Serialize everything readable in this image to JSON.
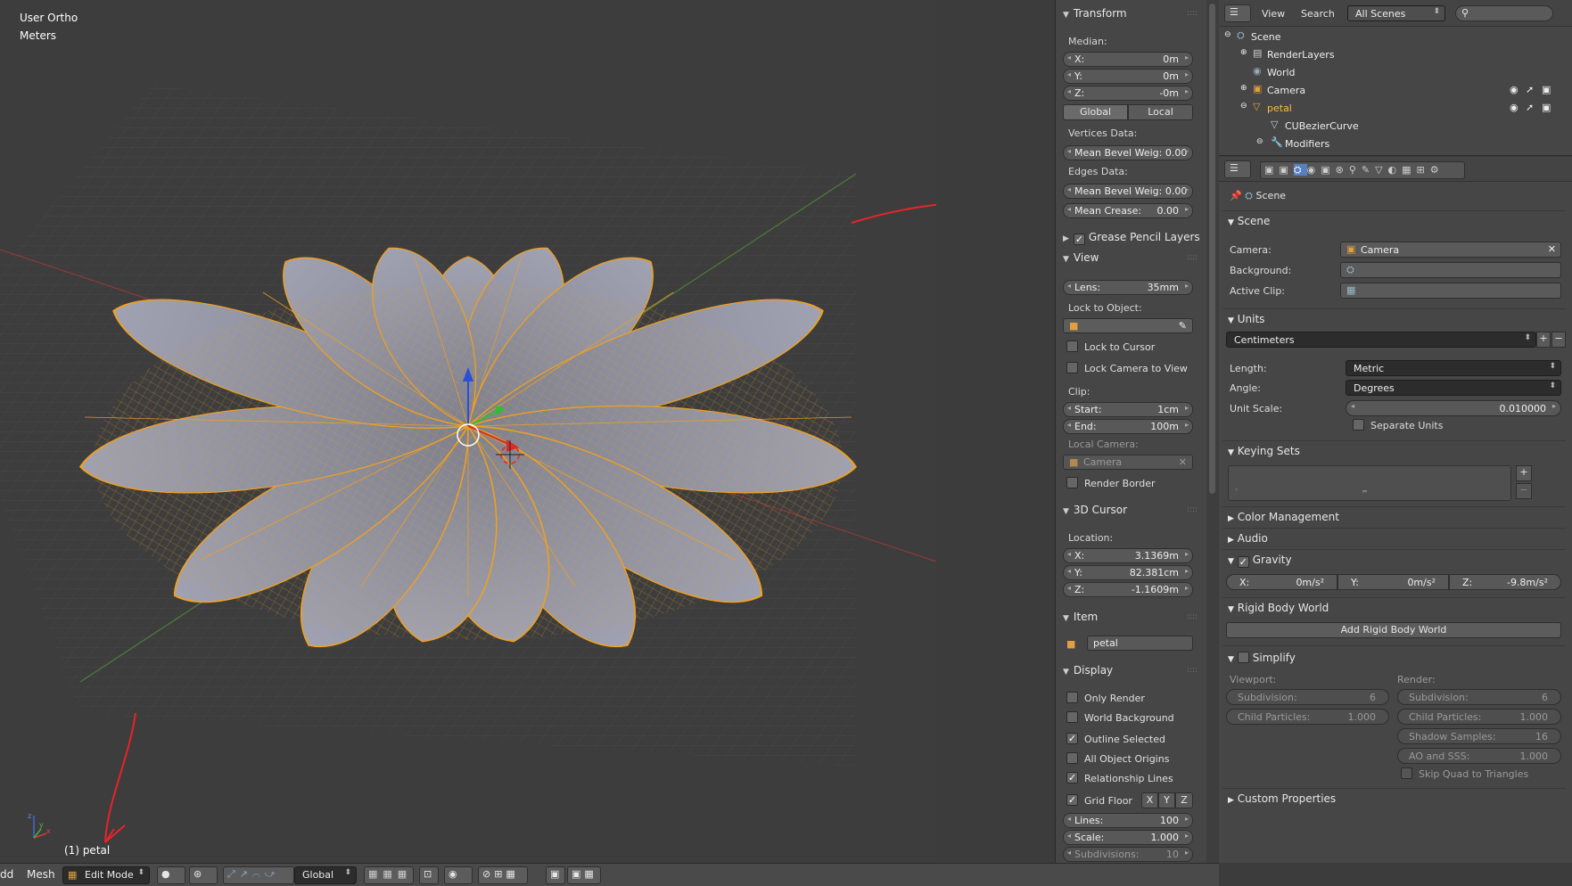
{
  "viewport": {
    "view_name": "User Ortho",
    "units": "Meters",
    "object_label": "(1) petal"
  },
  "npanel": {
    "transform": {
      "title": "Transform",
      "median_label": "Median:",
      "x": {
        "k": "X:",
        "v": "0m"
      },
      "y": {
        "k": "Y:",
        "v": "0m"
      },
      "z": {
        "k": "Z:",
        "v": "-0m"
      },
      "global": "Global",
      "local": "Local",
      "vertices_data": "Vertices Data:",
      "mean_bevel_v": "Mean Bevel Weig: 0.00",
      "edges_data": "Edges Data:",
      "mean_bevel_e": "Mean Bevel Weig: 0.00",
      "mean_crease_k": "Mean Crease:",
      "mean_crease_v": "0.00"
    },
    "grease_pencil": "Grease Pencil Layers",
    "view": {
      "title": "View",
      "lens_k": "Lens:",
      "lens_v": "35mm",
      "lock_to_object": "Lock to Object:",
      "lock_to_cursor": "Lock to Cursor",
      "lock_camera": "Lock Camera to View",
      "clip": "Clip:",
      "start_k": "Start:",
      "start_v": "1cm",
      "end_k": "End:",
      "end_v": "100m",
      "local_camera": "Local Camera:",
      "camera": "Camera",
      "render_border": "Render Border"
    },
    "cursor": {
      "title": "3D Cursor",
      "location": "Location:",
      "x": {
        "k": "X:",
        "v": "3.1369m"
      },
      "y": {
        "k": "Y:",
        "v": "82.381cm"
      },
      "z": {
        "k": "Z:",
        "v": "-1.1609m"
      }
    },
    "item": {
      "title": "Item",
      "name": "petal"
    },
    "display": {
      "title": "Display",
      "only_render": "Only Render",
      "world_background": "World Background",
      "outline_selected": "Outline Selected",
      "all_object_origins": "All Object Origins",
      "relationship_lines": "Relationship Lines",
      "grid_floor": "Grid Floor",
      "x": "X",
      "y": "Y",
      "z": "Z",
      "lines_k": "Lines:",
      "lines_v": "100",
      "scale_k": "Scale:",
      "scale_v": "1.000",
      "subdiv_k": "Subdivisions:",
      "subdiv_v": "10"
    }
  },
  "outliner": {
    "view": "View",
    "search": "Search",
    "scenes": "All Scenes",
    "items": [
      {
        "label": "Scene"
      },
      {
        "label": "RenderLayers"
      },
      {
        "label": "World"
      },
      {
        "label": "Camera"
      },
      {
        "label": "petal"
      },
      {
        "label": "CUBezierCurve"
      },
      {
        "label": "Modifiers"
      }
    ]
  },
  "properties": {
    "breadcrumb": "Scene",
    "scene": {
      "title": "Scene",
      "camera_k": "Camera:",
      "camera_v": "Camera",
      "background_k": "Background:",
      "active_clip_k": "Active Clip:"
    },
    "units": {
      "title": "Units",
      "preset": "Centimeters",
      "length_k": "Length:",
      "length_v": "Metric",
      "angle_k": "Angle:",
      "angle_v": "Degrees",
      "scale_k": "Unit Scale:",
      "scale_v": "0.010000",
      "separate": "Separate Units"
    },
    "keying_sets": "Keying Sets",
    "color_management": "Color Management",
    "audio": "Audio",
    "gravity": {
      "title": "Gravity",
      "x_k": "X:",
      "x_v": "0m/s²",
      "y_k": "Y:",
      "y_v": "0m/s²",
      "z_k": "Z:",
      "z_v": "-9.8m/s²"
    },
    "rigid_body": {
      "title": "Rigid Body World",
      "add": "Add Rigid Body World"
    },
    "simplify": {
      "title": "Simplify",
      "viewport": "Viewport:",
      "render": "Render:",
      "subdiv_k": "Subdivision:",
      "subdiv_v": "6",
      "child_k": "Child Particles:",
      "child_v": "1.000",
      "shadow_k": "Shadow Samples:",
      "shadow_v": "16",
      "ao_k": "AO and SSS:",
      "ao_v": "1.000",
      "skip_quad": "Skip Quad to Triangles"
    },
    "custom_props": "Custom Properties"
  },
  "bottombar": {
    "add": "dd",
    "mesh": "Mesh",
    "mode": "Edit Mode",
    "orientation": "Global"
  },
  "colors": {
    "accent_blue": "#5680c2",
    "mesh_orange": "#f0a020",
    "petal_gray": "#8c8e9c",
    "annotation_red": "#e8232a"
  }
}
